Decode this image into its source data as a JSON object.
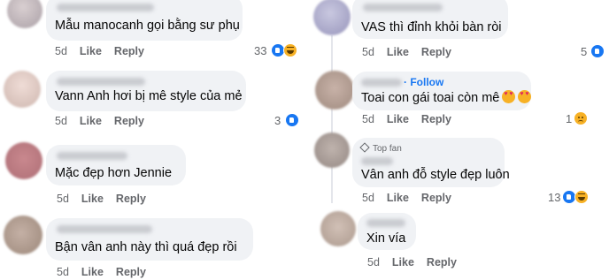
{
  "actions": {
    "like": "Like",
    "reply": "Reply"
  },
  "left_comments": [
    {
      "text": "Mẫu manocanh gọi bằng sư phụ",
      "time": "5d",
      "reactions": "33"
    },
    {
      "text": "Vann Anh hơi bị mê style của mẻ",
      "time": "5d",
      "reactions": "3"
    },
    {
      "text": "Mặc đẹp hơn Jennie",
      "time": "5d",
      "reactions": ""
    },
    {
      "text": "Bận vân anh này thì quá đẹp rồi",
      "time": "5d",
      "reactions": ""
    }
  ],
  "right_comments": [
    {
      "text": "VAS thì đỉnh khỏi bàn ròi",
      "time": "5d",
      "reactions": "5"
    },
    {
      "text": "Toai con gái toai còn mê",
      "time": "5d",
      "reactions": "1",
      "follow": "· Follow"
    },
    {
      "text": "Vân anh đỗ style đẹp luôn",
      "time": "5d",
      "reactions": "13",
      "badge": "Top fan"
    },
    {
      "text": "Xin vía",
      "time": "5d",
      "reactions": ""
    }
  ],
  "colors": {
    "bubble": "#f0f2f5",
    "meta_text": "#65676b",
    "link": "#1877f2",
    "like": "#1877f2",
    "haha": "#f7b125"
  }
}
